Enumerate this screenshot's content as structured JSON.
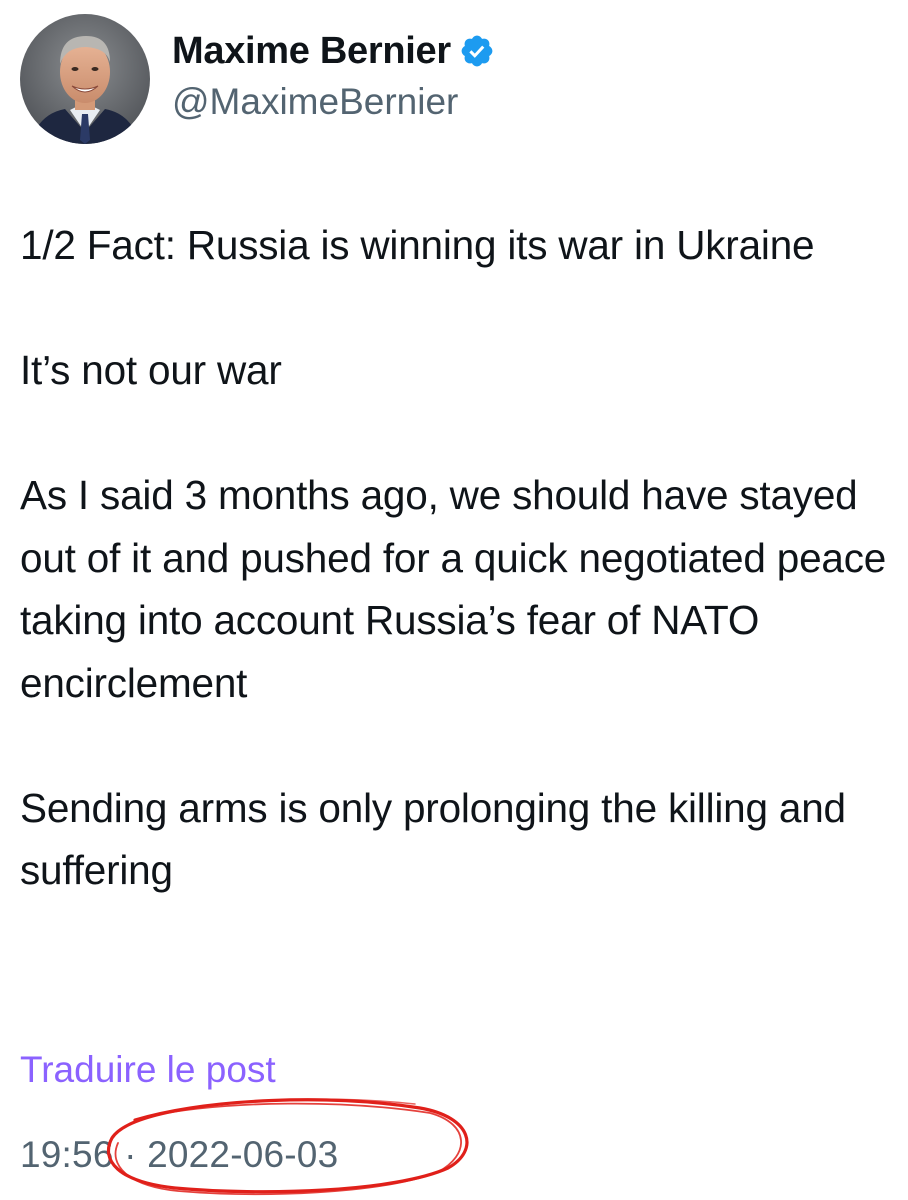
{
  "author": {
    "display_name": "Maxime Bernier",
    "handle": "@MaximeBernier",
    "verified": true,
    "verified_icon": "verified-badge-icon",
    "verified_color": "#1d9bf0"
  },
  "tweet": {
    "paragraphs": [
      "1/2 Fact: Russia is winning its war in Ukraine",
      "It’s not our war",
      "As I said 3 months ago, we should have stayed out of it and pushed for a quick negotiated peace taking into account Russia’s fear of NATO encirclement",
      "Sending arms is only prolonging the killing and suffering"
    ],
    "translate_label": "Traduire le post",
    "time": "19:56",
    "separator": "·",
    "date": "2022-06-03"
  },
  "colors": {
    "text": "#0f1419",
    "secondary": "#536471",
    "translate_link": "#8b62ff",
    "annotation_circle": "#e0201a"
  }
}
